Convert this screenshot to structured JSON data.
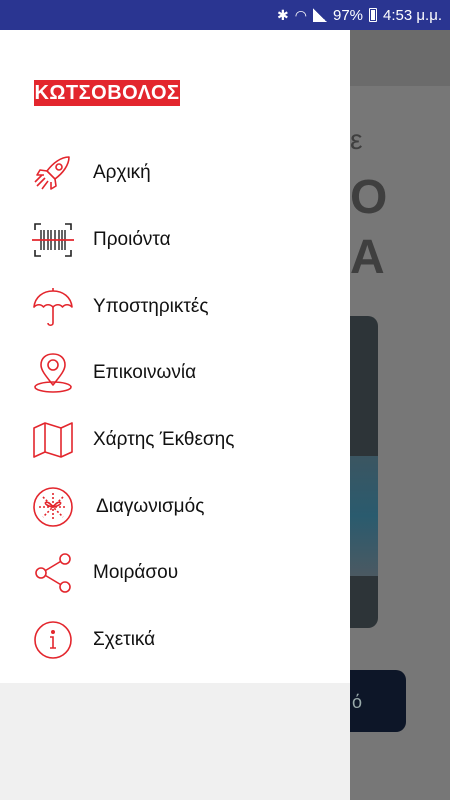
{
  "status_bar": {
    "battery": "97%",
    "time": "4:53 μ.μ."
  },
  "drawer": {
    "brand": "ΚΩΤΣΟΒΟΛΟΣ",
    "items": [
      {
        "label": "Αρχική",
        "icon": "rocket-icon"
      },
      {
        "label": "Προιόντα",
        "icon": "barcode-scan-icon"
      },
      {
        "label": "Υποστηρικτές",
        "icon": "umbrella-icon"
      },
      {
        "label": "Επικοινωνία",
        "icon": "location-pin-icon"
      },
      {
        "label": "Χάρτης Έκθεσης",
        "icon": "map-icon"
      },
      {
        "label": "Διαγωνισμός",
        "icon": "gift-icon"
      },
      {
        "label": "Μοιράσου",
        "icon": "share-icon"
      },
      {
        "label": "Σχετικά",
        "icon": "info-icon"
      }
    ]
  },
  "background_app": {
    "heading_fragment": "ε",
    "big_letter_1": "Ο",
    "big_letter_2": "Α",
    "button_fragment": "ό"
  },
  "colors": {
    "accent": "#e3262d",
    "status_bar": "#2a3591"
  }
}
